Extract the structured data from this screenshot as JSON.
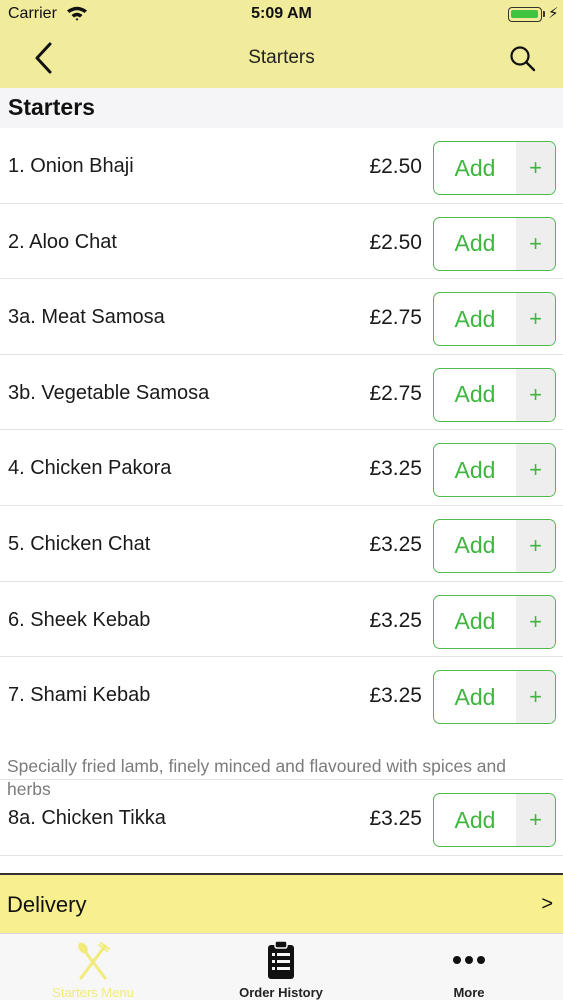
{
  "status_bar": {
    "carrier": "Carrier",
    "time": "5:09 AM",
    "icons": [
      "wifi-icon",
      "battery-icon",
      "charging-icon"
    ]
  },
  "nav": {
    "title": "Starters",
    "back_icon": "chevron-left-icon",
    "search_icon": "search-icon"
  },
  "section": {
    "title": "Starters"
  },
  "menu": {
    "add_label": "Add",
    "plus_label": "+",
    "items": [
      {
        "name": "1. Onion Bhaji",
        "price": "£2.50"
      },
      {
        "name": "2. Aloo Chat",
        "price": "£2.50"
      },
      {
        "name": "3a. Meat Samosa",
        "price": "£2.75"
      },
      {
        "name": "3b. Vegetable Samosa",
        "price": "£2.75"
      },
      {
        "name": "4. Chicken Pakora",
        "price": "£3.25"
      },
      {
        "name": "5. Chicken Chat",
        "price": "£3.25"
      },
      {
        "name": "6. Sheek Kebab",
        "price": "£3.25"
      },
      {
        "name": "7. Shami Kebab",
        "price": "£3.25",
        "description": "Specially fried lamb, finely minced and flavoured with spices and herbs"
      },
      {
        "name": "8a. Chicken Tikka",
        "price": "£3.25"
      }
    ]
  },
  "delivery": {
    "label": "Delivery",
    "arrow": ">"
  },
  "tabs": [
    {
      "label": "Starters Menu",
      "icon": "fork-knife-icon",
      "active": true
    },
    {
      "label": "Order History",
      "icon": "clipboard-icon",
      "active": false
    },
    {
      "label": "More",
      "icon": "more-dots-icon",
      "active": false
    }
  ],
  "colors": {
    "header": "#f1eb9c",
    "delivery_bar": "#f8f08e",
    "accent_green": "#3fb63f",
    "active_tab": "#f2eb7c"
  }
}
